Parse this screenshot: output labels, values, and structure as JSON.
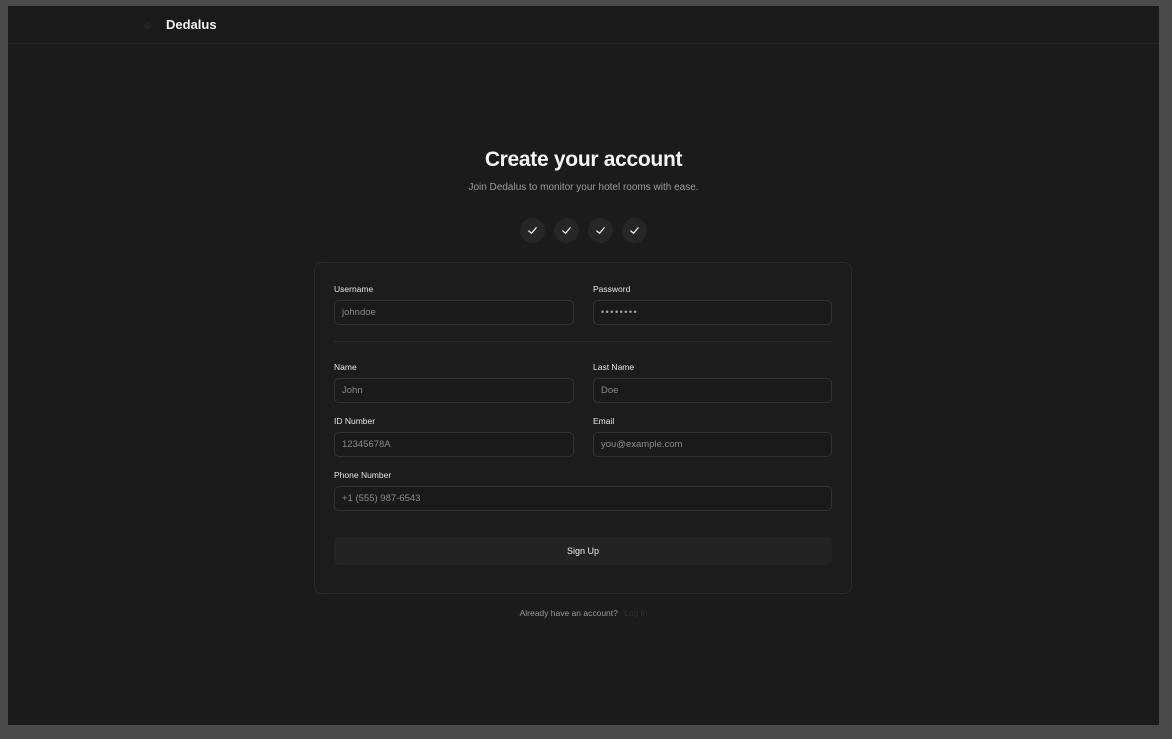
{
  "header": {
    "brand": "Dedalus",
    "logo_icon": "logo-icon"
  },
  "main": {
    "title": "Create your account",
    "subtitle": "Join Dedalus to monitor your hotel rooms with ease."
  },
  "steps": [
    {
      "icon": "check-icon",
      "done": true
    },
    {
      "icon": "check-icon",
      "done": true
    },
    {
      "icon": "check-icon",
      "done": true
    },
    {
      "icon": "check-icon",
      "done": true
    }
  ],
  "form": {
    "username": {
      "label": "Username",
      "placeholder": "johndoe"
    },
    "password": {
      "label": "Password",
      "value": "••••••••"
    },
    "name": {
      "label": "Name",
      "placeholder": "John"
    },
    "last_name": {
      "label": "Last Name",
      "placeholder": "Doe"
    },
    "id_number": {
      "label": "ID Number",
      "placeholder": "12345678A"
    },
    "email": {
      "label": "Email",
      "placeholder": "you@example.com"
    },
    "phone": {
      "label": "Phone Number",
      "placeholder": "+1 (555) 987-6543"
    },
    "submit_label": "Sign Up"
  },
  "footer": {
    "prompt": "Already have an account?",
    "link": "Log in"
  }
}
